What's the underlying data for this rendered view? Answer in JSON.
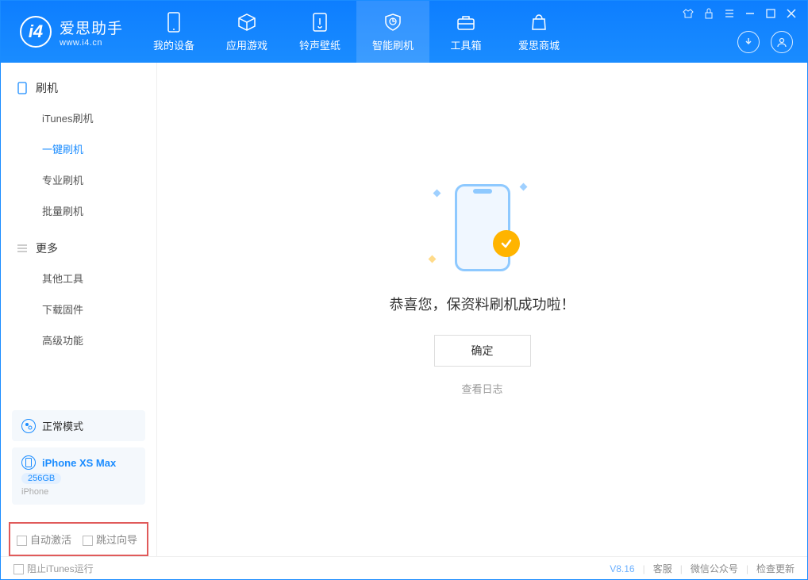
{
  "app": {
    "name": "爱思助手",
    "url": "www.i4.cn"
  },
  "nav": {
    "tabs": [
      {
        "label": "我的设备",
        "icon": "device"
      },
      {
        "label": "应用游戏",
        "icon": "cube"
      },
      {
        "label": "铃声壁纸",
        "icon": "music"
      },
      {
        "label": "智能刷机",
        "icon": "shield",
        "active": true
      },
      {
        "label": "工具箱",
        "icon": "toolbox"
      },
      {
        "label": "爱思商城",
        "icon": "bag"
      }
    ]
  },
  "sidebar": {
    "group1": {
      "title": "刷机",
      "items": [
        {
          "label": "iTunes刷机"
        },
        {
          "label": "一键刷机",
          "active": true
        },
        {
          "label": "专业刷机"
        },
        {
          "label": "批量刷机"
        }
      ]
    },
    "group2": {
      "title": "更多",
      "items": [
        {
          "label": "其他工具"
        },
        {
          "label": "下载固件"
        },
        {
          "label": "高级功能"
        }
      ]
    },
    "mode": "正常模式",
    "device": {
      "name": "iPhone XS Max",
      "storage": "256GB",
      "type": "iPhone"
    },
    "options": {
      "auto_activate": "自动激活",
      "skip_guide": "跳过向导"
    }
  },
  "main": {
    "success_text": "恭喜您，保资料刷机成功啦！",
    "ok_button": "确定",
    "view_log": "查看日志"
  },
  "footer": {
    "block_itunes": "阻止iTunes运行",
    "version": "V8.16",
    "links": [
      "客服",
      "微信公众号",
      "检查更新"
    ]
  }
}
